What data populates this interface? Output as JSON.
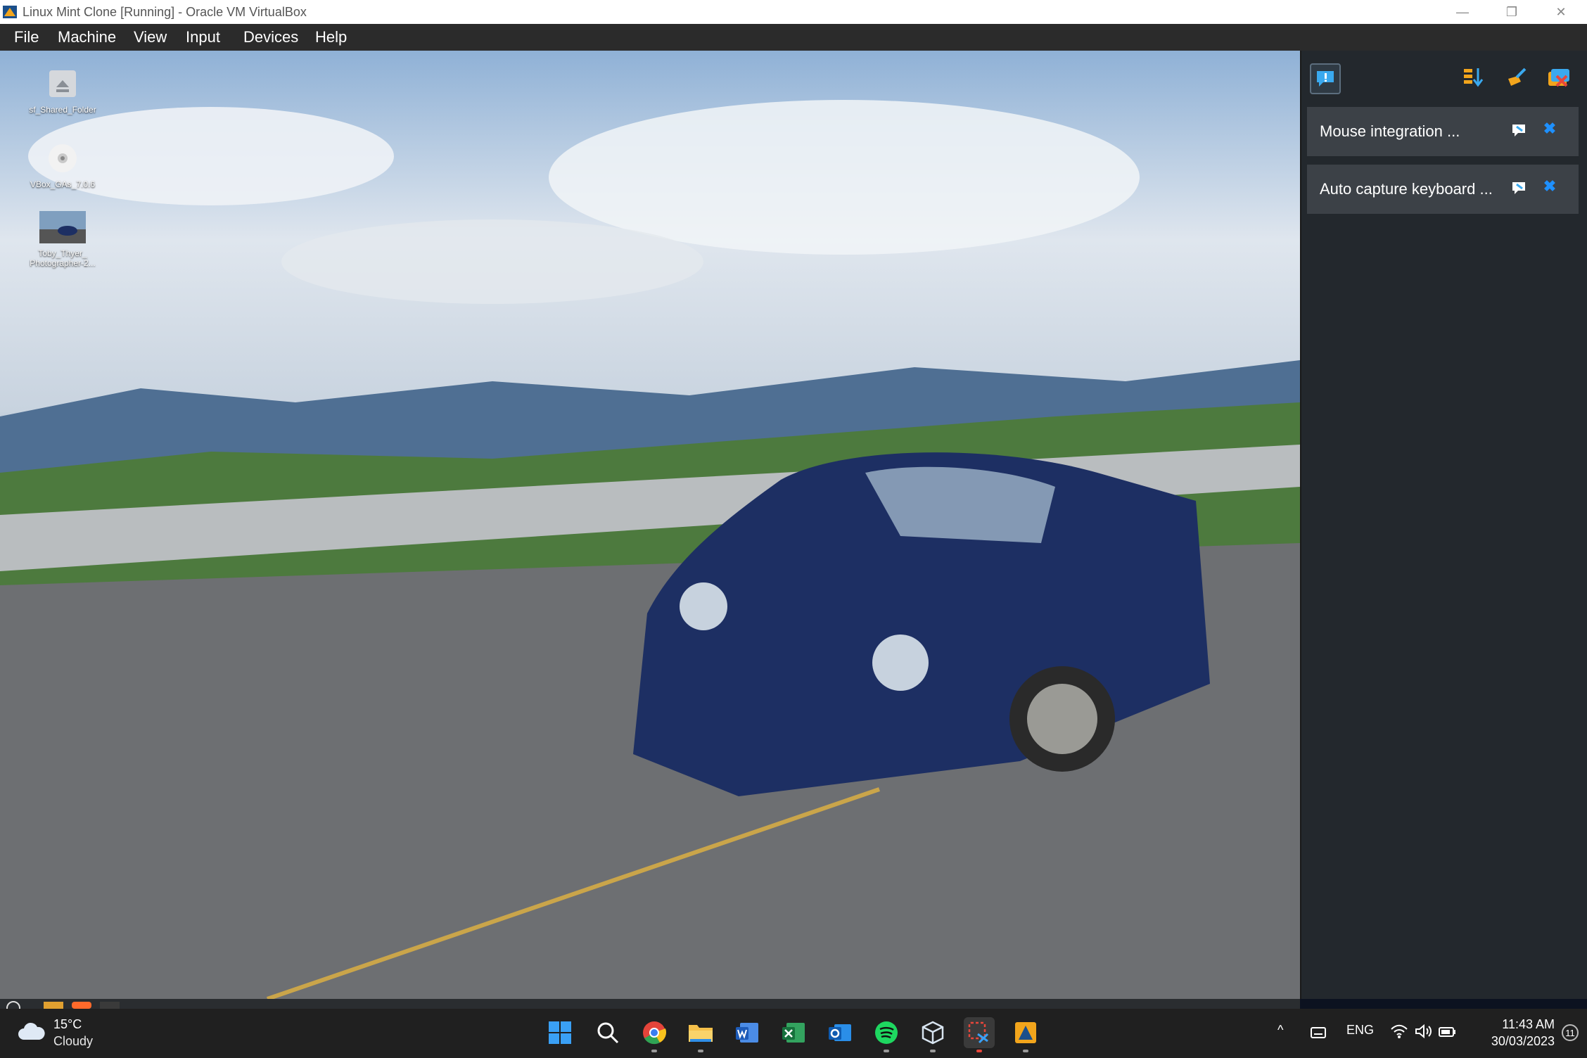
{
  "window": {
    "title": "Linux Mint Clone [Running] - Oracle VM VirtualBox",
    "controls": {
      "minimize": "—",
      "restore": "❐",
      "close": "✕"
    }
  },
  "menu": [
    "File",
    "Machine",
    "View",
    "Input",
    "Devices",
    "Help"
  ],
  "desktop": {
    "icons": [
      {
        "label": "sf_Shared_Folder",
        "icon": "shared-folder-icon"
      },
      {
        "label": "VBox_GAs_7.0.6",
        "icon": "cd-disc-icon"
      },
      {
        "label": "Toby_Thyer_ Photographer-2...",
        "icon": "image-thumbnail-icon"
      }
    ]
  },
  "notification_panel": {
    "items": [
      {
        "label": "Mouse integration ..."
      },
      {
        "label": "Auto capture keyboard ..."
      }
    ],
    "close_glyph": "✖"
  },
  "taskbar": {
    "weather": {
      "temp": "15°C",
      "condition": "Cloudy"
    },
    "apps": [
      "start",
      "search",
      "chrome",
      "file-explorer",
      "word",
      "excel",
      "outlook",
      "spotify",
      "virtualbox-cube",
      "snipping-tool",
      "virtualbox"
    ],
    "tray": {
      "chevron": "^",
      "language": "ENG"
    },
    "clock": {
      "time": "11:43 AM",
      "date": "30/03/2023"
    },
    "notifications_count": "11"
  },
  "colors": {
    "menubar": "#2b2b2b",
    "taskbar": "#202020",
    "accent": "#1e90ff"
  }
}
